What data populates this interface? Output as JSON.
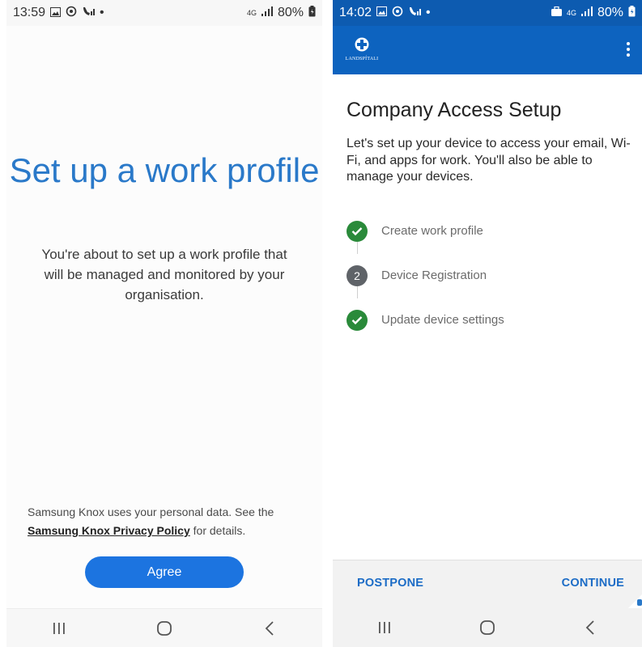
{
  "left_screen": {
    "status": {
      "time": "13:59",
      "network": "4G",
      "battery": "80%"
    },
    "title": "Set up a work profile",
    "description": "You're about to set up a work profile that will be managed and monitored by your organisation.",
    "privacy": {
      "prefix": "Samsung Knox uses your personal data. See the ",
      "link": "Samsung Knox Privacy Policy",
      "suffix": " for details."
    },
    "agree_label": "Agree"
  },
  "right_screen": {
    "status": {
      "time": "14:02",
      "network": "4G",
      "battery": "80%"
    },
    "app_logo_text": "LANDSPÍTALI",
    "heading": "Company Access Setup",
    "intro": "Let's set up your device to access your email, Wi-Fi, and apps for work. You'll also be able to manage your devices.",
    "steps": [
      {
        "label": "Create work profile",
        "state": "done",
        "marker": ""
      },
      {
        "label": "Device Registration",
        "state": "pending",
        "marker": "2"
      },
      {
        "label": "Update device settings",
        "state": "done",
        "marker": ""
      }
    ],
    "postpone_label": "POSTPONE",
    "continue_label": "CONTINUE"
  },
  "colors": {
    "accent_blue": "#1c74e0",
    "appbar_blue": "#0d63bf",
    "status_blue": "#0d5bb0",
    "step_done": "#2a8a3a",
    "step_pending": "#5f6368",
    "title_blue": "#2a79c9"
  },
  "icons": {
    "status": [
      "gallery-icon",
      "sync-icon",
      "wifi-call-icon",
      "dot-icon",
      "signal-icon",
      "battery-icon"
    ],
    "nav": [
      "recents-icon",
      "home-icon",
      "back-icon"
    ],
    "appbar": [
      "hospital-logo-icon",
      "more-vert-icon"
    ],
    "steps": [
      "check-icon",
      "step-number-icon"
    ]
  }
}
